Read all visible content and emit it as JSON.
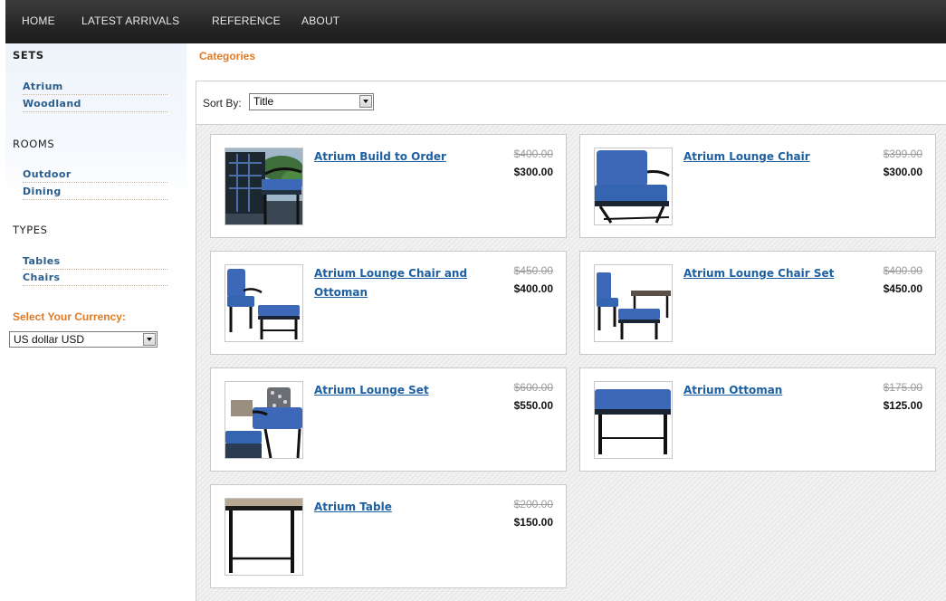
{
  "nav": {
    "items": [
      {
        "label": "HOME"
      },
      {
        "label": "LATEST ARRIVALS"
      },
      {
        "label": "REFERENCE"
      },
      {
        "label": "ABOUT"
      }
    ]
  },
  "sidebar": {
    "sets_heading": "SETS",
    "sets": [
      {
        "label": "Atrium"
      },
      {
        "label": "Woodland"
      }
    ],
    "rooms_heading": "ROOMS",
    "rooms": [
      {
        "label": "Outdoor"
      },
      {
        "label": "Dining"
      }
    ],
    "types_heading": "TYPES",
    "types": [
      {
        "label": "Tables"
      },
      {
        "label": "Chairs"
      }
    ],
    "currency_label": "Select Your Currency:",
    "currency_value": "US dollar USD"
  },
  "main": {
    "categories_title": "Categories",
    "sort_label": "Sort By:",
    "sort_value": "Title",
    "products": [
      {
        "title": "Atrium Build to Order",
        "old_price": "$400.00",
        "price": "$300.00",
        "image": "patio-chair-garden"
      },
      {
        "title": "Atrium Lounge Chair",
        "old_price": "$399.00",
        "price": "$300.00",
        "image": "lounge-chair"
      },
      {
        "title": "Atrium Lounge Chair and Ottoman",
        "old_price": "$450.00",
        "price": "$400.00",
        "image": "chair-and-ottoman"
      },
      {
        "title": "Atrium Lounge Chair Set",
        "old_price": "$400.00",
        "price": "$450.00",
        "image": "chair-set"
      },
      {
        "title": "Atrium Lounge Set",
        "old_price": "$600.00",
        "price": "$550.00",
        "image": "lounge-set"
      },
      {
        "title": "Atrium Ottoman",
        "old_price": "$175.00",
        "price": "$125.00",
        "image": "ottoman"
      },
      {
        "title": "Atrium Table",
        "old_price": "$200.00",
        "price": "$150.00",
        "image": "table"
      }
    ]
  },
  "colors": {
    "accent_orange": "#e07a22",
    "link_blue": "#1d5fa0",
    "cushion_blue": "#3d68b8",
    "nav_dark": "#2a2a2a"
  }
}
